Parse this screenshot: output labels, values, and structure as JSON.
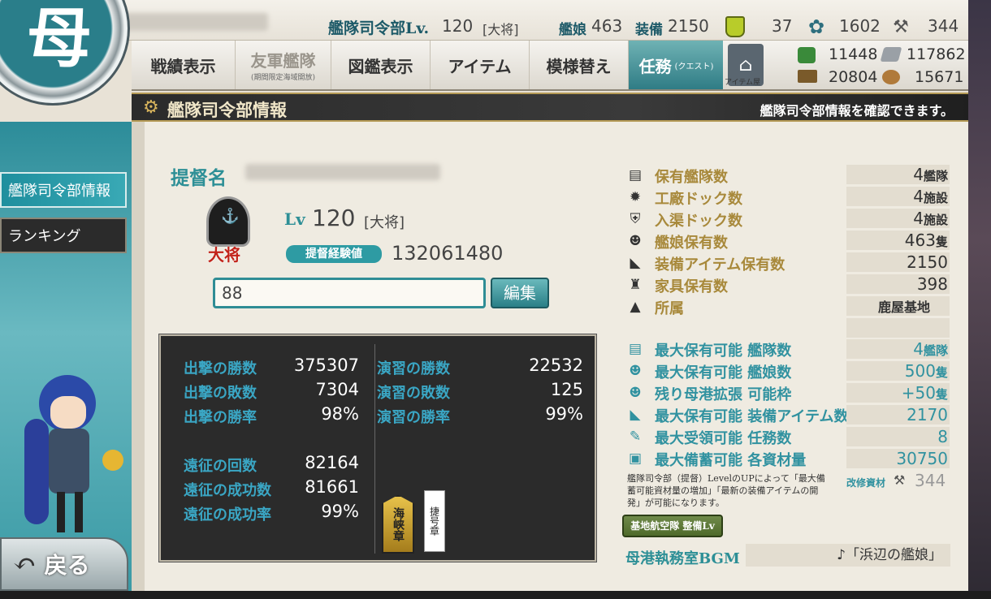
{
  "top": {
    "hq_label": "艦隊司令部Lv.",
    "hq_level": "120",
    "hq_rank": "[大将]",
    "ships_label": "艦娘",
    "ships_count": "463",
    "equip_label": "装備",
    "equip_count": "2150",
    "bucket_count": "37",
    "devmat_count": "1602",
    "screw_count": "344"
  },
  "nav": {
    "items": [
      {
        "label": "戦績表示"
      },
      {
        "label": "友軍艦隊",
        "sub": "(期間限定海域開放)"
      },
      {
        "label": "図鑑表示"
      },
      {
        "label": "アイテム"
      },
      {
        "label": "模様替え"
      },
      {
        "label": "任務",
        "sub": "(クエスト)"
      }
    ],
    "item_shop_label": "アイテム屋"
  },
  "resources": {
    "fuel": "11448",
    "steel": "117862",
    "ammo": "20804",
    "bauxite": "15671"
  },
  "band": {
    "title": "艦隊司令部情報",
    "description": "艦隊司令部情報を確認できます。"
  },
  "sidebar": {
    "items": [
      {
        "label": "艦隊司令部情報"
      },
      {
        "label": "ランキング"
      }
    ],
    "back_label": "戻る"
  },
  "profile": {
    "name_label": "提督名",
    "lv_label": "Lv",
    "level": "120",
    "rank": "[大将]",
    "rank_badge": "大将",
    "exp_label": "提督経験値",
    "exp_value": "132061480",
    "comment_value": "88",
    "edit_label": "編集"
  },
  "records": {
    "sortie_wins_label": "出撃の勝数",
    "sortie_wins": "375307",
    "sortie_losses_label": "出撃の敗数",
    "sortie_losses": "7304",
    "sortie_rate_label": "出撃の勝率",
    "sortie_rate": "98%",
    "exercise_wins_label": "演習の勝数",
    "exercise_wins": "22532",
    "exercise_losses_label": "演習の敗数",
    "exercise_losses": "125",
    "exercise_rate_label": "演習の勝率",
    "exercise_rate": "99%",
    "expedition_count_label": "遠征の回数",
    "expedition_count": "82164",
    "expedition_success_label": "遠征の成功数",
    "expedition_success": "81661",
    "expedition_rate_label": "遠征の成功率",
    "expedition_rate": "99%",
    "medal1_text": "海峡章",
    "medal2_text": "捷号章"
  },
  "stats": {
    "fleets_label": "保有艦隊数",
    "fleets_value": "4",
    "fleets_unit": "艦隊",
    "build_docks_label": "工廠ドック数",
    "build_docks_value": "4",
    "build_docks_unit": "施設",
    "repair_docks_label": "入渠ドック数",
    "repair_docks_value": "4",
    "repair_docks_unit": "施設",
    "ships_label": "艦娘保有数",
    "ships_value": "463",
    "ships_unit": "隻",
    "equip_label": "装備アイテム保有数",
    "equip_value": "2150",
    "furniture_label": "家具保有数",
    "furniture_value": "398",
    "base_label": "所属",
    "base_value": "鹿屋基地",
    "max_fleets_label": "最大保有可能 艦隊数",
    "max_fleets_value": "4",
    "max_fleets_unit": "艦隊",
    "max_ships_label": "最大保有可能 艦娘数",
    "max_ships_value": "500",
    "max_ships_unit": "隻",
    "port_expand_label": "残り母港拡張 可能枠",
    "port_expand_value": "+50",
    "port_expand_unit": "隻",
    "max_equip_label": "最大保有可能 装備アイテム数",
    "max_equip_value": "2170",
    "max_quests_label": "最大受領可能 任務数",
    "max_quests_value": "8",
    "max_resources_label": "最大備蓄可能 各資材量",
    "max_resources_value": "30750",
    "note": "艦隊司令部（提督）LevelのUPによって「最大備蓄可能資材量の増加」「最新の装備アイテムの開発」が可能になります。",
    "improvement_label": "改修資材",
    "improvement_value": "344",
    "lbas_button": "基地航空隊 整備Lv",
    "bgm_label": "母港執務室BGM",
    "bgm_value": "♪「浜辺の艦娘」"
  }
}
